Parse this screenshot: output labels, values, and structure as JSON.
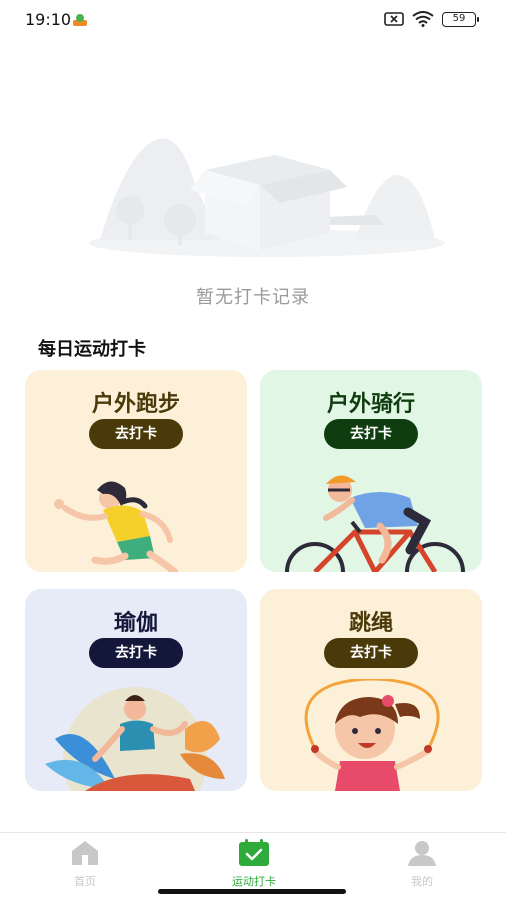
{
  "status_bar": {
    "time": "19:10",
    "battery": "59"
  },
  "empty_state": {
    "message": "暂无打卡记录"
  },
  "section": {
    "title": "每日运动打卡"
  },
  "cards": [
    {
      "title": "户外跑步",
      "button": "去打卡",
      "title_color": "#4a3a0a",
      "button_color": "#4a3a0a"
    },
    {
      "title": "户外骑行",
      "button": "去打卡",
      "title_color": "#0f3d10",
      "button_color": "#0f3d10"
    },
    {
      "title": "瑜伽",
      "button": "去打卡",
      "title_color": "#13173a",
      "button_color": "#13173a"
    },
    {
      "title": "跳绳",
      "button": "去打卡",
      "title_color": "#4a3a0a",
      "button_color": "#4a3a0a"
    }
  ],
  "bottom_nav": {
    "items": [
      {
        "label": "首页",
        "icon": "home-icon",
        "active": false
      },
      {
        "label": "运动打卡",
        "icon": "calendar-check-icon",
        "active": true
      },
      {
        "label": "我的",
        "icon": "user-icon",
        "active": false
      }
    ],
    "active_color": "#2eab3a",
    "inactive_color": "#c8c8c8"
  }
}
